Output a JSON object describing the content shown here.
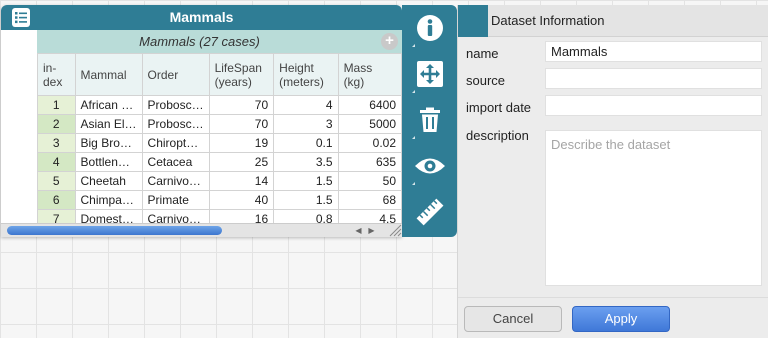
{
  "table": {
    "title": "Mammals",
    "collection_label": "Mammals (27 cases)",
    "add_symbol": "+",
    "headers": [
      "in-\ndex",
      "Mammal",
      "Order",
      "LifeSpan (years)",
      "Height (meters)",
      "Mass (kg)"
    ],
    "rows": [
      {
        "index": "1",
        "mammal": "African …",
        "order": "Probosc…",
        "lifespan": "70",
        "height": "4",
        "mass": "6400"
      },
      {
        "index": "2",
        "mammal": "Asian El…",
        "order": "Probosc…",
        "lifespan": "70",
        "height": "3",
        "mass": "5000"
      },
      {
        "index": "3",
        "mammal": "Big Bro…",
        "order": "Chiropt…",
        "lifespan": "19",
        "height": "0.1",
        "mass": "0.02"
      },
      {
        "index": "4",
        "mammal": "Bottlen…",
        "order": "Cetacea",
        "lifespan": "25",
        "height": "3.5",
        "mass": "635"
      },
      {
        "index": "5",
        "mammal": "Cheetah",
        "order": "Carnivo…",
        "lifespan": "14",
        "height": "1.5",
        "mass": "50"
      },
      {
        "index": "6",
        "mammal": "Chimpa…",
        "order": "Primate",
        "lifespan": "40",
        "height": "1.5",
        "mass": "68"
      },
      {
        "index": "7",
        "mammal": "Domest…",
        "order": "Carnivo…",
        "lifespan": "16",
        "height": "0.8",
        "mass": "4.5"
      }
    ]
  },
  "toolbar": {
    "tools": [
      "info-icon",
      "arrange-icon",
      "trash-icon",
      "eye-icon",
      "ruler-icon"
    ]
  },
  "panel": {
    "title": "Dataset Information",
    "labels": {
      "name": "name",
      "source": "source",
      "import_date": "import date",
      "description": "description"
    },
    "values": {
      "name": "Mammals",
      "source": "",
      "import_date": ""
    },
    "description_placeholder": "Describe the dataset",
    "cancel_label": "Cancel",
    "apply_label": "Apply"
  },
  "colors": {
    "accent": "#2f7d95",
    "collection_header": "#b9dcd8",
    "index_cell": "#e6f1d6",
    "apply_button": "#4a82e0"
  }
}
